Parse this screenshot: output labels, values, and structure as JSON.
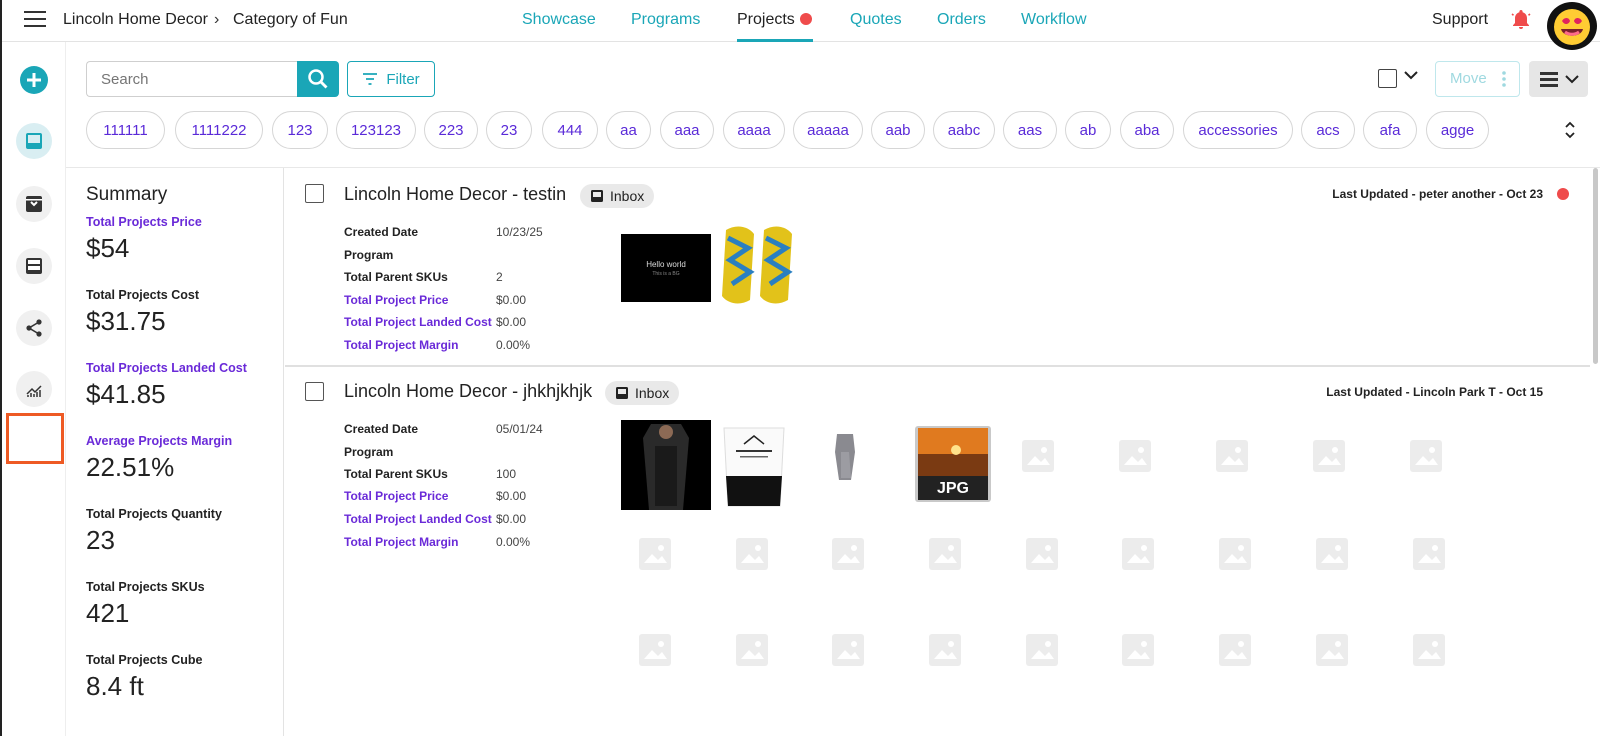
{
  "header": {
    "breadcrumb": [
      "Lincoln Home Decor",
      "Category of Fun"
    ],
    "nav": [
      {
        "label": "Showcase"
      },
      {
        "label": "Programs"
      },
      {
        "label": "Projects"
      },
      {
        "label": "Quotes"
      },
      {
        "label": "Orders"
      },
      {
        "label": "Workflow"
      }
    ],
    "active_nav": "Projects",
    "support_label": "Support"
  },
  "toolbar": {
    "search_placeholder": "Search",
    "filter_label": "Filter",
    "move_label": "Move"
  },
  "tags": [
    "111111",
    "1111222",
    "123",
    "123123",
    "223",
    "23",
    "444",
    "aa",
    "aaa",
    "aaaa",
    "aaaaa",
    "aab",
    "aabc",
    "aas",
    "ab",
    "aba",
    "accessories",
    "acs",
    "afa",
    "agge"
  ],
  "summary": {
    "title": "Summary",
    "items": [
      {
        "label": "Total Projects Price",
        "value": "$54"
      },
      {
        "label": "Total Projects Cost",
        "value": "$31.75"
      },
      {
        "label": "Total Projects Landed Cost",
        "value": "$41.85"
      },
      {
        "label": "Average Projects Margin",
        "value": "22.51%"
      },
      {
        "label": "Total Projects Quantity",
        "value": "23"
      },
      {
        "label": "Total Projects SKUs",
        "value": "421"
      },
      {
        "label": "Total Projects Cube",
        "value": "8.4 ft"
      }
    ]
  },
  "field_labels": {
    "created": "Created Date",
    "program": "Program",
    "parent_skus": "Total Parent SKUs",
    "price": "Total Project Price",
    "landed": "Total Project Landed Cost",
    "margin": "Total Project Margin"
  },
  "projects": [
    {
      "title": "Lincoln Home Decor - testin",
      "folder": "Inbox",
      "last_updated": "Last Updated - peter another - Oct 23",
      "created": "10/23/25",
      "program": "",
      "parent_skus": "2",
      "price": "$0.00",
      "landed": "$0.00",
      "margin": "0.00%",
      "thumb_texts": [
        "Hello world",
        "This is a BG"
      ]
    },
    {
      "title": "Lincoln Home Decor - jhkhjkhjk",
      "folder": "Inbox",
      "last_updated": "Last Updated - Lincoln Park T - Oct 15",
      "created": "05/01/24",
      "program": "",
      "parent_skus": "100",
      "price": "$0.00",
      "landed": "$0.00",
      "margin": "0.00%",
      "thumb_texts": [
        "JPG"
      ]
    }
  ],
  "colors": {
    "accent": "#1aa6b7",
    "purple": "#6a2ad8",
    "alert": "#ef4b4b",
    "highlight": "#ee5a24"
  }
}
